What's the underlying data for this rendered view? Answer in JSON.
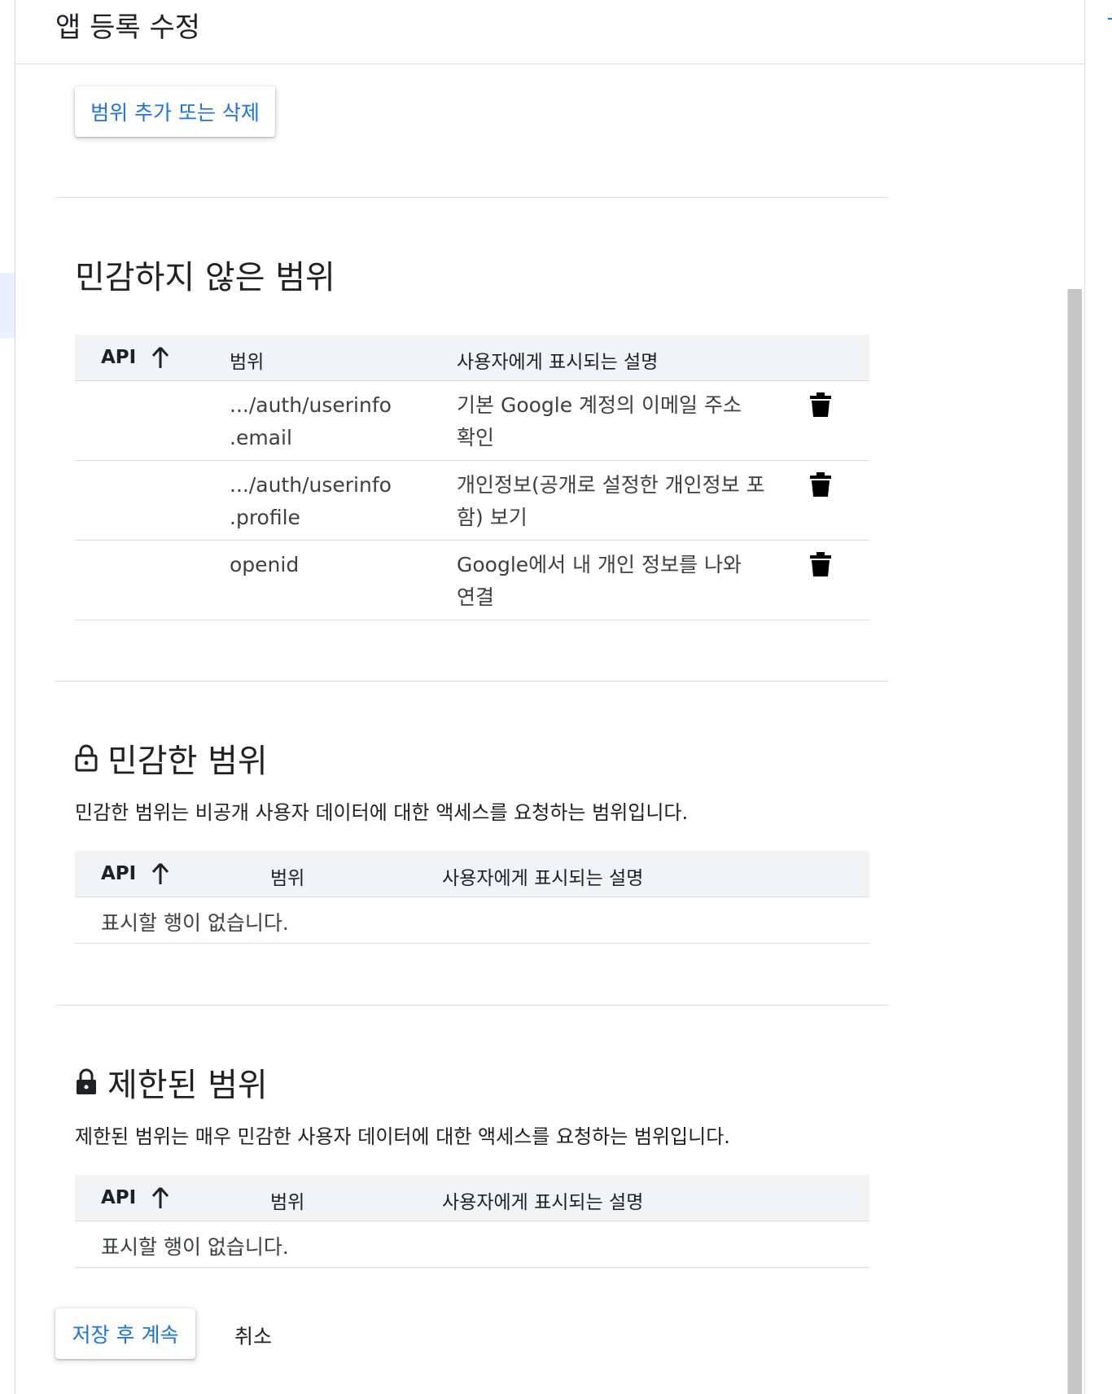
{
  "header": {
    "title": "앱 등록 수정"
  },
  "scope_button_label": "범위 추가 또는 삭제",
  "non_sensitive": {
    "title": "민감하지 않은 범위",
    "columns": {
      "api": "API",
      "scope": "범위",
      "desc": "사용자에게 표시되는 설명"
    },
    "rows": [
      {
        "scope_line1": ".../auth/userinfo",
        "scope_line2": ".email",
        "desc": "기본 Google 계정의 이메일 주소 확인"
      },
      {
        "scope_line1": ".../auth/userinfo",
        "scope_line2": ".profile",
        "desc": "개인정보(공개로 설정한 개인정보 포함) 보기"
      },
      {
        "scope_line1": "openid",
        "scope_line2": "",
        "desc": "Google에서 내 개인 정보를 나와 연결"
      }
    ]
  },
  "sensitive": {
    "title": "민감한 범위",
    "description": "민감한 범위는 비공개 사용자 데이터에 대한 액세스를 요청하는 범위입니다.",
    "columns": {
      "api": "API",
      "scope": "범위",
      "desc": "사용자에게 표시되는 설명"
    },
    "empty_text": "표시할 행이 없습니다."
  },
  "restricted": {
    "title": "제한된 범위",
    "description": "제한된 범위는 매우 민감한 사용자 데이터에 대한 액세스를 요청하는 범위입니다.",
    "columns": {
      "api": "API",
      "scope": "범위",
      "desc": "사용자에게 표시되는 설명"
    },
    "empty_text": "표시할 행이 없습니다."
  },
  "footer": {
    "save_label": "저장 후 계속",
    "cancel_label": "취소"
  },
  "icons": {
    "sort": "arrow-up-icon",
    "delete": "trash-icon",
    "sensitive": "lock-open-icon",
    "restricted": "lock-icon"
  },
  "colors": {
    "accent": "#1a73e8",
    "header_bg": "#f1f3f4",
    "divider": "#dadce0"
  }
}
